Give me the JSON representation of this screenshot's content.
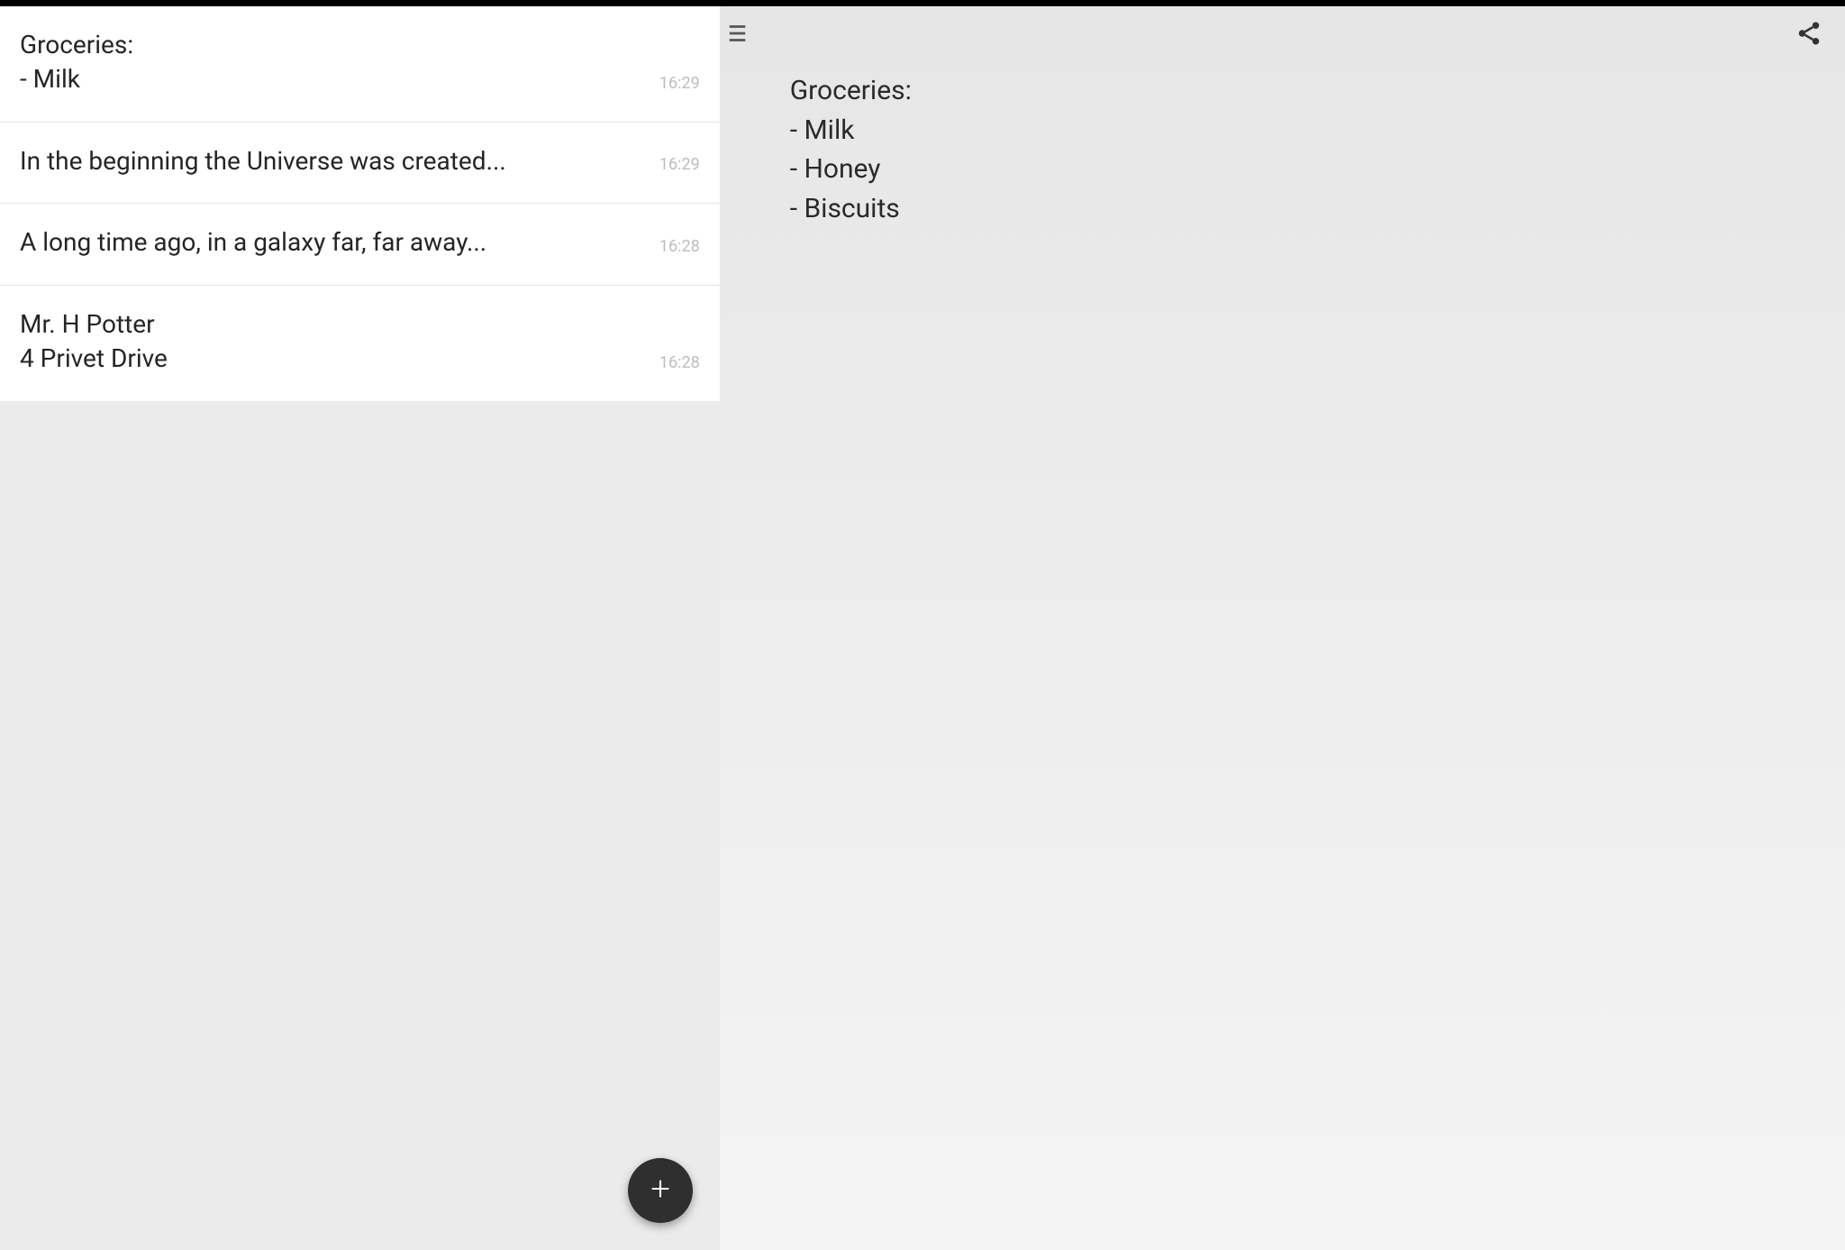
{
  "notes": [
    {
      "preview": "Groceries:\n- Milk",
      "time": "16:29"
    },
    {
      "preview": "In the beginning the Universe was created...",
      "time": "16:29"
    },
    {
      "preview": "A long time ago, in a galaxy far, far away...",
      "time": "16:28"
    },
    {
      "preview": "Mr. H Potter\n4 Privet Drive",
      "time": "16:28"
    }
  ],
  "detail": {
    "content": "Groceries:\n- Milk\n- Honey\n- Biscuits"
  },
  "icons": {
    "plus": "plus-icon",
    "menu": "menu-icon",
    "share": "share-icon"
  }
}
